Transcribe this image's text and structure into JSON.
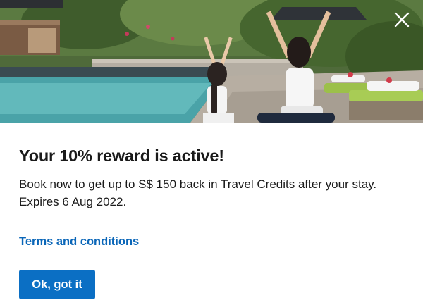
{
  "dialog": {
    "title": "Your 10% reward is active!",
    "description_line1": "Book now to get up to S$ 150 back in Travel Credits after your stay.",
    "description_line2": "Expires 6 Aug 2022.",
    "terms_link": "Terms and conditions",
    "ok_button": "Ok, got it",
    "close_icon": "close-icon"
  },
  "colors": {
    "link": "#0a66b8",
    "button_bg": "#0b6fc4",
    "button_text": "#ffffff",
    "title_text": "#1a1a1a"
  }
}
